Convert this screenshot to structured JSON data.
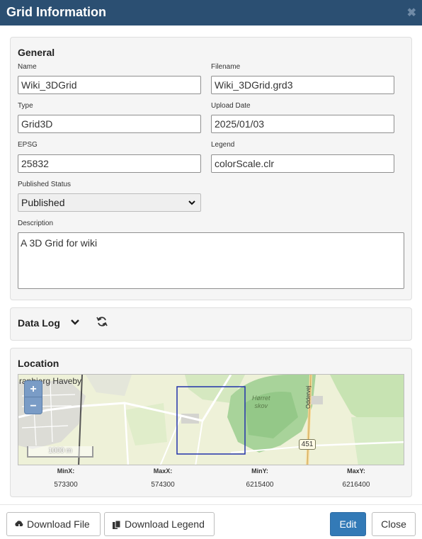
{
  "dialog": {
    "title": "Grid Information",
    "close_glyph": "✖"
  },
  "general": {
    "heading": "General",
    "name": {
      "label": "Name",
      "value": "Wiki_3DGrid"
    },
    "filename": {
      "label": "Filename",
      "value": "Wiki_3DGrid.grd3"
    },
    "type": {
      "label": "Type",
      "value": "Grid3D"
    },
    "upload_date": {
      "label": "Upload Date",
      "value": "2025/01/03"
    },
    "epsg": {
      "label": "EPSG",
      "value": "25832"
    },
    "legend": {
      "label": "Legend",
      "value": "colorScale.clr"
    },
    "published_status": {
      "label": "Published Status",
      "value": "Published"
    },
    "description": {
      "label": "Description",
      "value": "A 3D Grid for wiki"
    }
  },
  "data_log": {
    "heading": "Data Log",
    "chevron_icon": "chevron-down-icon",
    "refresh_icon": "refresh-icon"
  },
  "location": {
    "heading": "Location",
    "map": {
      "town_label": "ranbjerg Haveby",
      "forest_label_1": "Hørret",
      "forest_label_2": "skov",
      "road_label": "Oddervej",
      "road_shield": "451",
      "zoom_in": "+",
      "zoom_out": "−",
      "scale_label": "1000 m"
    },
    "coords": [
      {
        "label": "MinX:",
        "value": "573300"
      },
      {
        "label": "MaxX:",
        "value": "574300"
      },
      {
        "label": "MinY:",
        "value": "6215400"
      },
      {
        "label": "MaxY:",
        "value": "6216400"
      }
    ]
  },
  "footer": {
    "download_file": "Download File",
    "download_legend": "Download Legend",
    "edit": "Edit",
    "close": "Close"
  },
  "colors": {
    "titlebar": "#2b4f72",
    "primary": "#337ab7",
    "bbox": "#2233aa"
  }
}
